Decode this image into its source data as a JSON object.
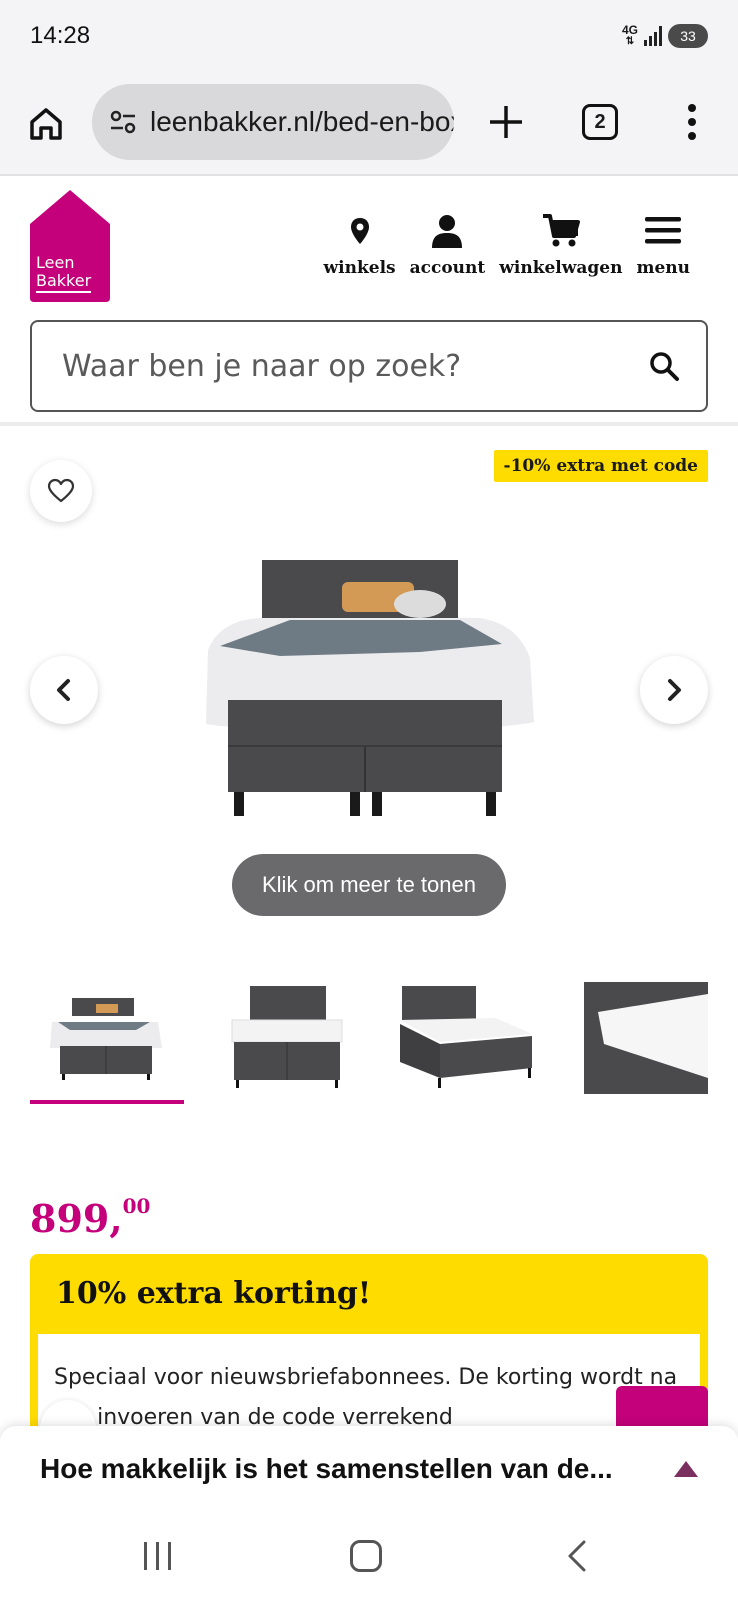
{
  "status_bar": {
    "time": "14:28",
    "network": "4G",
    "battery": "33"
  },
  "browser": {
    "url": "leenbakker.nl/bed-en-boxspring",
    "tab_count": "2"
  },
  "header": {
    "logo_line1": "Leen",
    "logo_line2": "Bakker",
    "nav": [
      {
        "label": "winkels",
        "icon": "location-pin-icon"
      },
      {
        "label": "account",
        "icon": "user-icon"
      },
      {
        "label": "winkelwagen",
        "icon": "cart-icon"
      },
      {
        "label": "menu",
        "icon": "hamburger-icon"
      }
    ],
    "search_placeholder": "Waar ben je naar op zoek?"
  },
  "gallery": {
    "promo_tag": "-10% extra met code",
    "more_label": "Klik om meer te tonen",
    "thumbnail_count": 4,
    "active_thumbnail": 0
  },
  "product": {
    "price_main": "899,",
    "price_cents": "00"
  },
  "discount": {
    "title": "10% extra korting!",
    "body": "Speciaal voor nieuwsbriefabonnees. De korting wordt na het invoeren van de code verrekend"
  },
  "sheet": {
    "text": "Hoe makkelijk is het samenstellen van de..."
  },
  "colors": {
    "brand": "#c4007a",
    "promo": "#ffdc00"
  }
}
